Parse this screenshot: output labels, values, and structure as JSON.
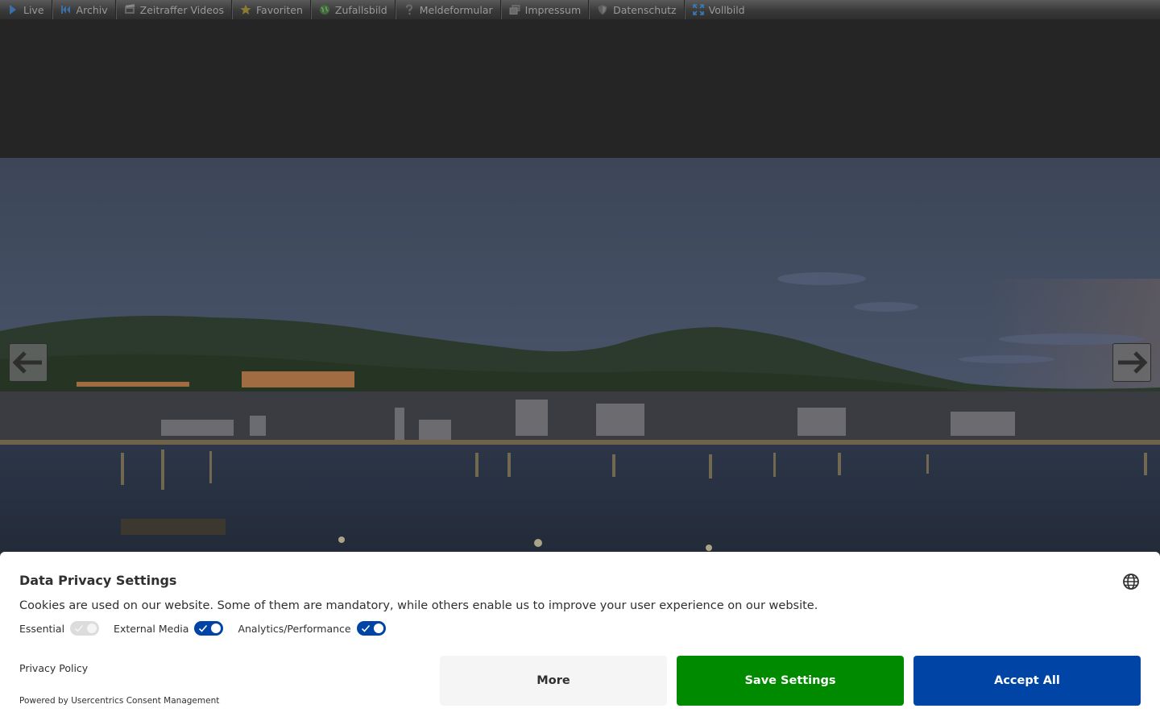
{
  "nav": {
    "items": [
      {
        "label": "Live",
        "icon": "play-icon"
      },
      {
        "label": "Archiv",
        "icon": "rewind-icon"
      },
      {
        "label": "Zeitraffer Videos",
        "icon": "film-icon"
      },
      {
        "label": "Favoriten",
        "icon": "star-icon"
      },
      {
        "label": "Zufallsbild",
        "icon": "globe-icon"
      },
      {
        "label": "Meldeformular",
        "icon": "question-icon"
      },
      {
        "label": "Impressum",
        "icon": "windows-icon"
      },
      {
        "label": "Datenschutz",
        "icon": "shield-icon"
      },
      {
        "label": "Vollbild",
        "icon": "fullscreen-icon"
      }
    ]
  },
  "webcam": {
    "prev_icon": "arrow-left-icon",
    "next_icon": "arrow-right-icon"
  },
  "consent": {
    "title": "Data Privacy Settings",
    "language_icon": "globe-icon",
    "text": "Cookies are used on our website. Some of them are mandatory, while others enable us to improve your user experience on our website.",
    "toggles": [
      {
        "label": "Essential",
        "state": "on",
        "disabled": true
      },
      {
        "label": "External Media",
        "state": "on",
        "disabled": false
      },
      {
        "label": "Analytics/Performance",
        "state": "on",
        "disabled": false
      }
    ],
    "privacy_link": "Privacy Policy",
    "powered_by": "Powered by Usercentrics Consent Management",
    "buttons": {
      "more": "More",
      "save": "Save Settings",
      "accept": "Accept All"
    },
    "colors": {
      "save": "#008a00",
      "accept": "#0045a5",
      "more": "#f5f5f5",
      "toggle_on": "#0045a5"
    }
  }
}
